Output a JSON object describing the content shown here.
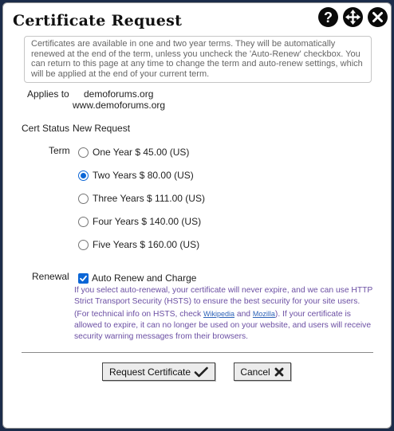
{
  "dialog": {
    "title": "Certificate Request",
    "icons": [
      "help-icon",
      "move-icon",
      "close-icon"
    ]
  },
  "info_text": "Certificates are available in one and two year terms. They will be automatically renewed at the end of the term, unless you uncheck the 'Auto-Renew' checkbox. You can return to this page at any time to change the term and auto-renew settings, which will be applied at the end of your current term.",
  "applies_to": {
    "label": "Applies to",
    "domains": [
      "demoforums.org",
      "www.demoforums.org"
    ]
  },
  "cert_status": {
    "label": "Cert Status",
    "value": "New Request"
  },
  "term": {
    "label": "Term",
    "options": [
      {
        "label": "One Year $ 45.00 (US)",
        "selected": false
      },
      {
        "label": "Two Years $ 80.00 (US)",
        "selected": true
      },
      {
        "label": "Three Years $ 111.00 (US)",
        "selected": false
      },
      {
        "label": "Four Years $ 140.00 (US)",
        "selected": false
      },
      {
        "label": "Five Years $ 160.00 (US)",
        "selected": false
      }
    ]
  },
  "renewal": {
    "label": "Renewal",
    "checkbox_label": "Auto Renew and Charge",
    "checked": true,
    "text_part1": "If you select auto-renewal, your certificate will never expire, and we can use HTTP Strict Transport Security (HSTS) to ensure the best security for your site users. (For technical info on HSTS, check ",
    "link1": "Wikipedia",
    "text_and": " and ",
    "link2": "Mozilla",
    "text_part2": "). If your certificate is allowed to expire, it can no longer be used on your website, and users will receive security warning messages from their browsers."
  },
  "buttons": {
    "request": "Request Certificate",
    "cancel": "Cancel"
  },
  "colors": {
    "accent": "#0b66d6",
    "note_text": "#6b4fa3",
    "link": "#2e63b8"
  }
}
